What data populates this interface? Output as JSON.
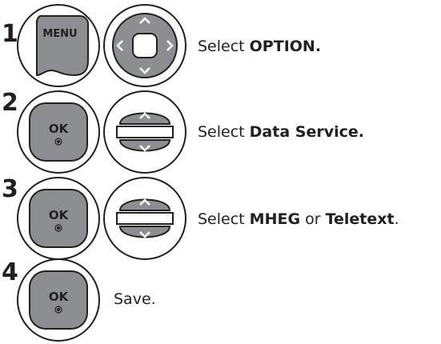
{
  "steps": [
    {
      "number": "1",
      "buttons": [
        "menu-button",
        "navigation-4way"
      ],
      "menu_label": "MENU",
      "text": [
        {
          "t": "Select ",
          "bold": false
        },
        {
          "t": "OPTION.",
          "bold": true
        }
      ]
    },
    {
      "number": "2",
      "buttons": [
        "ok-button",
        "navigation-updown"
      ],
      "ok_label": "OK",
      "text": [
        {
          "t": "Select ",
          "bold": false
        },
        {
          "t": "Data Service.",
          "bold": true
        }
      ]
    },
    {
      "number": "3",
      "buttons": [
        "ok-button",
        "navigation-updown"
      ],
      "ok_label": "OK",
      "text": [
        {
          "t": "Select ",
          "bold": false
        },
        {
          "t": "MHEG",
          "bold": true
        },
        {
          "t": " or ",
          "bold": false
        },
        {
          "t": "Teletext",
          "bold": true
        },
        {
          "t": ".",
          "bold": false
        }
      ]
    },
    {
      "number": "4",
      "buttons": [
        "ok-button"
      ],
      "ok_label": "OK",
      "text": [
        {
          "t": "Save.",
          "bold": false
        }
      ]
    }
  ],
  "colors": {
    "button_fill": "#8c8e92",
    "outline": "#231f20",
    "text": "#231f20"
  }
}
